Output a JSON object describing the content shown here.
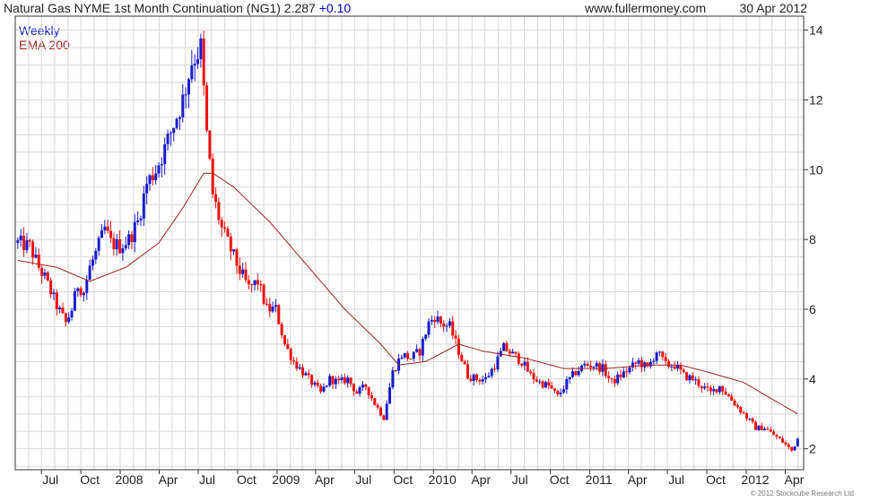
{
  "header": {
    "title": "Natural Gas NYME 1st Month Continuation (NG1) 2.287",
    "change": "+0.10",
    "site": "www.fullermoney.com",
    "date": "30 Apr 2012"
  },
  "legend": {
    "series1": "Weekly",
    "series2": "EMA 200"
  },
  "footer": {
    "copyright": "© 2012 Stockcube Research Ltd"
  },
  "colors": {
    "up": "#1a1acc",
    "down": "#ee1111",
    "ema": "#a02020",
    "grid": "#d7d7d7",
    "axis": "#333333"
  },
  "chart_data": {
    "type": "line",
    "subtype": "candlestick",
    "title": "Natural Gas NYME 1st Month Continuation (NG1)",
    "last_value": 2.287,
    "change": 0.1,
    "grid": true,
    "y_axis_side": "right",
    "ylim": [
      1.4,
      14.4
    ],
    "yticks": [
      2,
      4,
      6,
      8,
      10,
      12,
      14
    ],
    "x_ticks": [
      {
        "label": "Jul",
        "date": "2007-07-01"
      },
      {
        "label": "Oct",
        "date": "2007-10-01"
      },
      {
        "label": "2008",
        "date": "2008-01-01"
      },
      {
        "label": "Apr",
        "date": "2008-04-01"
      },
      {
        "label": "Jul",
        "date": "2008-07-01"
      },
      {
        "label": "Oct",
        "date": "2008-10-01"
      },
      {
        "label": "2009",
        "date": "2009-01-01"
      },
      {
        "label": "Apr",
        "date": "2009-04-01"
      },
      {
        "label": "Jul",
        "date": "2009-07-01"
      },
      {
        "label": "Oct",
        "date": "2009-10-01"
      },
      {
        "label": "2010",
        "date": "2010-01-01"
      },
      {
        "label": "Apr",
        "date": "2010-04-01"
      },
      {
        "label": "Jul",
        "date": "2010-07-01"
      },
      {
        "label": "Oct",
        "date": "2010-10-01"
      },
      {
        "label": "2011",
        "date": "2011-01-01"
      },
      {
        "label": "Apr",
        "date": "2011-04-01"
      },
      {
        "label": "Jul",
        "date": "2011-07-01"
      },
      {
        "label": "Oct",
        "date": "2011-10-01"
      },
      {
        "label": "2012",
        "date": "2012-01-01"
      },
      {
        "label": "Apr",
        "date": "2012-04-01"
      }
    ],
    "series": [
      {
        "name": "Weekly",
        "kind": "close",
        "points": [
          [
            "2007-05-07",
            7.9
          ],
          [
            "2007-06-04",
            7.8
          ],
          [
            "2007-06-25",
            7.2
          ],
          [
            "2007-07-09",
            6.9
          ],
          [
            "2007-07-23",
            6.5
          ],
          [
            "2007-08-06",
            6.1
          ],
          [
            "2007-08-27",
            5.6
          ],
          [
            "2007-09-10",
            6.0
          ],
          [
            "2007-09-24",
            6.7
          ],
          [
            "2007-10-08",
            6.5
          ],
          [
            "2007-10-22",
            7.2
          ],
          [
            "2007-11-05",
            7.6
          ],
          [
            "2007-11-26",
            8.3
          ],
          [
            "2007-12-10",
            7.9
          ],
          [
            "2007-12-31",
            7.8
          ],
          [
            "2008-01-21",
            8.0
          ],
          [
            "2008-02-11",
            8.5
          ],
          [
            "2008-03-03",
            9.6
          ],
          [
            "2008-03-24",
            10.0
          ],
          [
            "2008-04-14",
            10.6
          ],
          [
            "2008-05-05",
            11.3
          ],
          [
            "2008-05-26",
            12.0
          ],
          [
            "2008-06-16",
            13.1
          ],
          [
            "2008-07-07",
            13.5
          ],
          [
            "2008-07-21",
            11.0
          ],
          [
            "2008-08-04",
            9.3
          ],
          [
            "2008-08-25",
            8.3
          ],
          [
            "2008-09-15",
            7.7
          ],
          [
            "2008-10-06",
            7.1
          ],
          [
            "2008-10-27",
            6.6
          ],
          [
            "2008-11-17",
            6.8
          ],
          [
            "2008-12-08",
            6.0
          ],
          [
            "2008-12-29",
            6.0
          ],
          [
            "2009-01-19",
            5.0
          ],
          [
            "2009-02-09",
            4.5
          ],
          [
            "2009-03-02",
            4.2
          ],
          [
            "2009-03-23",
            3.9
          ],
          [
            "2009-04-13",
            3.6
          ],
          [
            "2009-05-04",
            4.0
          ],
          [
            "2009-05-25",
            3.9
          ],
          [
            "2009-06-15",
            4.0
          ],
          [
            "2009-07-06",
            3.6
          ],
          [
            "2009-07-27",
            3.8
          ],
          [
            "2009-08-17",
            3.3
          ],
          [
            "2009-09-07",
            2.9
          ],
          [
            "2009-09-28",
            4.2
          ],
          [
            "2009-10-19",
            4.7
          ],
          [
            "2009-11-09",
            4.6
          ],
          [
            "2009-11-30",
            4.8
          ],
          [
            "2009-12-21",
            5.6
          ],
          [
            "2010-01-04",
            5.8
          ],
          [
            "2010-01-18",
            5.6
          ],
          [
            "2010-02-08",
            5.5
          ],
          [
            "2010-03-01",
            4.8
          ],
          [
            "2010-03-22",
            4.1
          ],
          [
            "2010-04-12",
            4.0
          ],
          [
            "2010-05-03",
            4.0
          ],
          [
            "2010-05-24",
            4.4
          ],
          [
            "2010-06-14",
            4.9
          ],
          [
            "2010-07-05",
            4.7
          ],
          [
            "2010-07-26",
            4.5
          ],
          [
            "2010-08-16",
            4.1
          ],
          [
            "2010-09-06",
            3.9
          ],
          [
            "2010-09-27",
            3.8
          ],
          [
            "2010-10-18",
            3.5
          ],
          [
            "2010-11-08",
            3.9
          ],
          [
            "2010-11-29",
            4.2
          ],
          [
            "2010-12-20",
            4.4
          ],
          [
            "2011-01-10",
            4.4
          ],
          [
            "2011-01-31",
            4.3
          ],
          [
            "2011-02-21",
            3.9
          ],
          [
            "2011-03-14",
            4.1
          ],
          [
            "2011-04-04",
            4.3
          ],
          [
            "2011-04-25",
            4.5
          ],
          [
            "2011-05-16",
            4.3
          ],
          [
            "2011-06-06",
            4.8
          ],
          [
            "2011-06-27",
            4.4
          ],
          [
            "2011-07-18",
            4.4
          ],
          [
            "2011-08-08",
            4.1
          ],
          [
            "2011-08-29",
            4.0
          ],
          [
            "2011-09-19",
            3.8
          ],
          [
            "2011-10-10",
            3.6
          ],
          [
            "2011-10-31",
            3.8
          ],
          [
            "2011-11-21",
            3.5
          ],
          [
            "2011-12-12",
            3.2
          ],
          [
            "2012-01-02",
            2.9
          ],
          [
            "2012-01-23",
            2.6
          ],
          [
            "2012-02-13",
            2.6
          ],
          [
            "2012-03-05",
            2.4
          ],
          [
            "2012-03-26",
            2.2
          ],
          [
            "2012-04-16",
            1.95
          ],
          [
            "2012-04-30",
            2.287
          ]
        ]
      },
      {
        "name": "EMA 200",
        "kind": "line",
        "points": [
          [
            "2007-05-07",
            7.4
          ],
          [
            "2007-08-06",
            7.2
          ],
          [
            "2007-10-22",
            6.8
          ],
          [
            "2008-01-14",
            7.2
          ],
          [
            "2008-03-31",
            7.9
          ],
          [
            "2008-05-26",
            8.9
          ],
          [
            "2008-07-14",
            9.9
          ],
          [
            "2008-08-04",
            9.9
          ],
          [
            "2008-09-22",
            9.5
          ],
          [
            "2008-12-15",
            8.5
          ],
          [
            "2009-03-09",
            7.3
          ],
          [
            "2009-06-08",
            6.0
          ],
          [
            "2009-08-31",
            5.0
          ],
          [
            "2009-10-12",
            4.4
          ],
          [
            "2009-12-14",
            4.5
          ],
          [
            "2010-03-01",
            5.0
          ],
          [
            "2010-04-26",
            4.8
          ],
          [
            "2010-08-02",
            4.6
          ],
          [
            "2010-11-01",
            4.3
          ],
          [
            "2011-02-07",
            4.3
          ],
          [
            "2011-05-16",
            4.4
          ],
          [
            "2011-08-01",
            4.4
          ],
          [
            "2011-10-03",
            4.2
          ],
          [
            "2011-12-26",
            3.9
          ],
          [
            "2012-03-05",
            3.4
          ],
          [
            "2012-04-30",
            3.0
          ]
        ]
      }
    ]
  }
}
